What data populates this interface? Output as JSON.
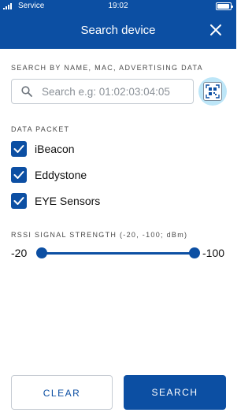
{
  "status_bar": {
    "carrier": "Service",
    "time": "19:02"
  },
  "header": {
    "title": "Search device",
    "close_icon": "close-icon"
  },
  "search": {
    "label": "SEARCH BY NAME, MAC, ADVERTISING DATA",
    "placeholder": "Search e.g: 01:02:03:04:05",
    "value": "",
    "qr_icon": "qr-scan-icon"
  },
  "data_packet": {
    "label": "DATA PACKET",
    "options": [
      {
        "label": "iBeacon",
        "checked": true
      },
      {
        "label": "Eddystone",
        "checked": true
      },
      {
        "label": "EYE Sensors",
        "checked": true
      }
    ]
  },
  "rssi": {
    "label": "RSSI SIGNAL STRENGTH (-20, -100; dBm)",
    "min_label": "-20",
    "max_label": "-100",
    "range": [
      -20,
      -100
    ],
    "selected": [
      -20,
      -100
    ]
  },
  "buttons": {
    "clear": "CLEAR",
    "search": "SEARCH"
  },
  "colors": {
    "primary": "#0c4fa3",
    "qr_highlight": "#bde6f8"
  }
}
